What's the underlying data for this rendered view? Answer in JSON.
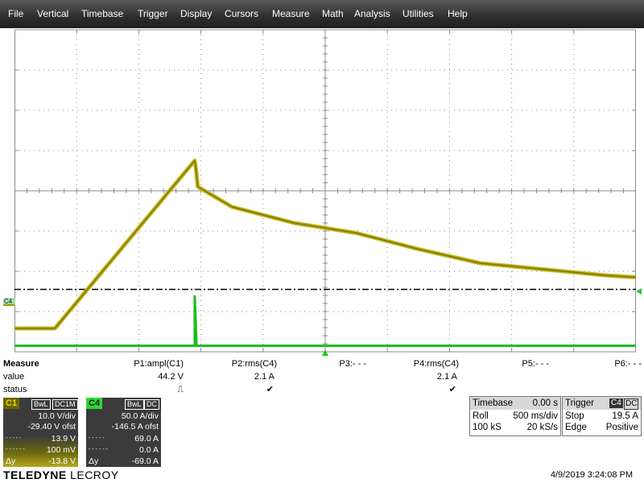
{
  "menu": [
    "File",
    "Vertical",
    "Timebase",
    "Trigger",
    "Display",
    "Cursors",
    "Measure",
    "Math",
    "Analysis",
    "Utilities",
    "Help"
  ],
  "colors": {
    "c1": "#9b9b00",
    "c1_fill": "#bfb21a",
    "c4": "#1fbf1f",
    "grid": "#8a8a8a",
    "dash": "#000000",
    "marker": "#22cc22"
  },
  "markers": {
    "c4_left": "C4",
    "trigger_icon": "trigger-triangle"
  },
  "measure": {
    "title": "Measure",
    "row_value": "value",
    "row_status": "status",
    "params": [
      {
        "name": "P1:ampl(C1)",
        "value": "44.2 V",
        "status": "⎍"
      },
      {
        "name": "P2:rms(C4)",
        "value": "2.1 A",
        "status": "✔"
      },
      {
        "name": "P3:- - -",
        "value": "",
        "status": ""
      },
      {
        "name": "P4:rms(C4)",
        "value": "2.1 A",
        "status": "✔"
      },
      {
        "name": "P5:- - -",
        "value": "",
        "status": ""
      },
      {
        "name": "P6:- - -",
        "value": "",
        "status": ""
      }
    ]
  },
  "channels": {
    "c1": {
      "name": "C1",
      "bw": "BwL",
      "coupling": "DC1M",
      "vdiv": "10.0 V/div",
      "offset": "-29.40 V ofst",
      "cur1_label": "- - - - -",
      "cur1": "13.9 V",
      "cur2_label": "- - - - - -",
      "cur2": "100 mV",
      "dy_label": "Δy",
      "dy": "-13.8 V"
    },
    "c4": {
      "name": "C4",
      "bw": "BwL",
      "coupling": "DC",
      "vdiv": "50.0 A/div",
      "offset": "-146.5 A ofst",
      "cur1_label": "- - - - -",
      "cur1": "69.0 A",
      "cur2_label": "- - - - - -",
      "cur2": "0.0 A",
      "dy_label": "Δy",
      "dy": "-69.0 A"
    }
  },
  "timebase": {
    "title": "Timebase",
    "delay": "0.00 s",
    "mode": "Roll",
    "tdiv": "500 ms/div",
    "samples": "100 kS",
    "rate": "20 kS/s"
  },
  "trigger": {
    "title": "Trigger",
    "ch": "C4",
    "coupling": "DC",
    "state": "Stop",
    "level": "19.5 A",
    "type": "Edge",
    "slope": "Positive"
  },
  "brand": {
    "part1": "TELEDYNE",
    "part2": " LECROY"
  },
  "datetime": "4/9/2019 3:24:08 PM",
  "chart_data": {
    "type": "line",
    "x_divisions": 10,
    "y_divisions": 8,
    "series": [
      {
        "name": "C1",
        "points": [
          [
            0,
            0.58
          ],
          [
            0.65,
            0.58
          ],
          [
            2.9,
            4.75
          ],
          [
            2.92,
            4.55
          ],
          [
            2.95,
            4.1
          ],
          [
            3.5,
            3.6
          ],
          [
            4.5,
            3.2
          ],
          [
            5.5,
            2.95
          ],
          [
            6.5,
            2.55
          ],
          [
            7.5,
            2.2
          ],
          [
            8.5,
            2.05
          ],
          [
            9.5,
            1.9
          ],
          [
            10,
            1.85
          ]
        ]
      },
      {
        "name": "C4",
        "points": [
          [
            0,
            0.15
          ],
          [
            2.9,
            0.15
          ],
          [
            2.9,
            1.4
          ],
          [
            2.93,
            0.15
          ],
          [
            10,
            0.15
          ]
        ]
      }
    ],
    "reference_y": 1.55
  }
}
